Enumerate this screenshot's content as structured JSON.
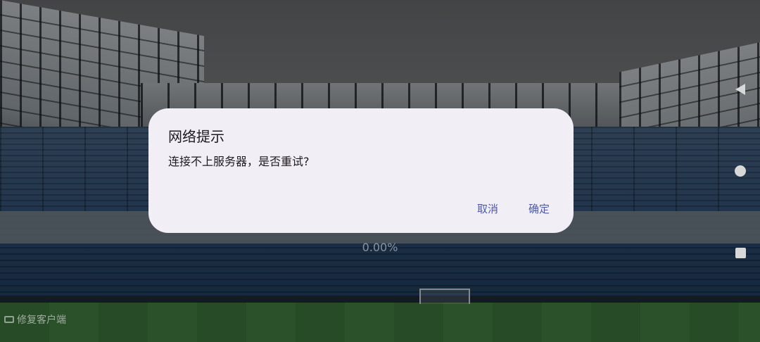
{
  "dialog": {
    "title": "网络提示",
    "message": "连接不上服务器，是否重试?",
    "cancel_label": "取消",
    "confirm_label": "确定"
  },
  "loading": {
    "progress_text": "0.00%"
  },
  "footer": {
    "repair_label": "修复客户端"
  },
  "navbar": {
    "icons": [
      "back-icon",
      "home-icon",
      "recents-icon"
    ]
  },
  "colors": {
    "dialog_bg": "#f2eef5",
    "button_text": "#4e5aa8",
    "scrim": "rgba(0,0,0,0.38)"
  }
}
